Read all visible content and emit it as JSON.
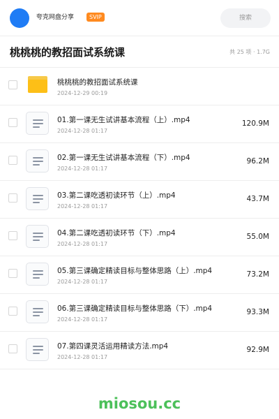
{
  "header": {
    "username": "夸克网盘分享",
    "badge": "SVIP",
    "search_placeholder": "搜索"
  },
  "folder": {
    "title": "桃桃桃的教招面试系统课",
    "meta": "共 25 项 · 1.7G"
  },
  "files": [
    {
      "type": "folder",
      "name": "桃桃桃的教招面试系统课",
      "date": "2024-12-29 00:19",
      "size": ""
    },
    {
      "type": "video",
      "name": "01.第一课无生试讲基本流程（上）.mp4",
      "date": "2024-12-28 01:17",
      "size": "120.9M"
    },
    {
      "type": "video",
      "name": "02.第一课无生试讲基本流程（下）.mp4",
      "date": "2024-12-28 01:17",
      "size": "96.2M"
    },
    {
      "type": "video",
      "name": "03.第二课吃透初读环节（上）.mp4",
      "date": "2024-12-28 01:17",
      "size": "43.7M"
    },
    {
      "type": "video",
      "name": "04.第二课吃透初读环节（下）.mp4",
      "date": "2024-12-28 01:17",
      "size": "55.0M"
    },
    {
      "type": "video",
      "name": "05.第三课确定精读目标与整体思路（上）.mp4",
      "date": "2024-12-28 01:17",
      "size": "73.2M"
    },
    {
      "type": "video",
      "name": "06.第三课确定精读目标与整体思路（下）.mp4",
      "date": "2024-12-28 01:17",
      "size": "93.3M"
    },
    {
      "type": "video",
      "name": "07.第四课灵活运用精读方法.mp4",
      "date": "2024-12-28 01:17",
      "size": "92.9M"
    }
  ],
  "watermark": "miosou.cc"
}
